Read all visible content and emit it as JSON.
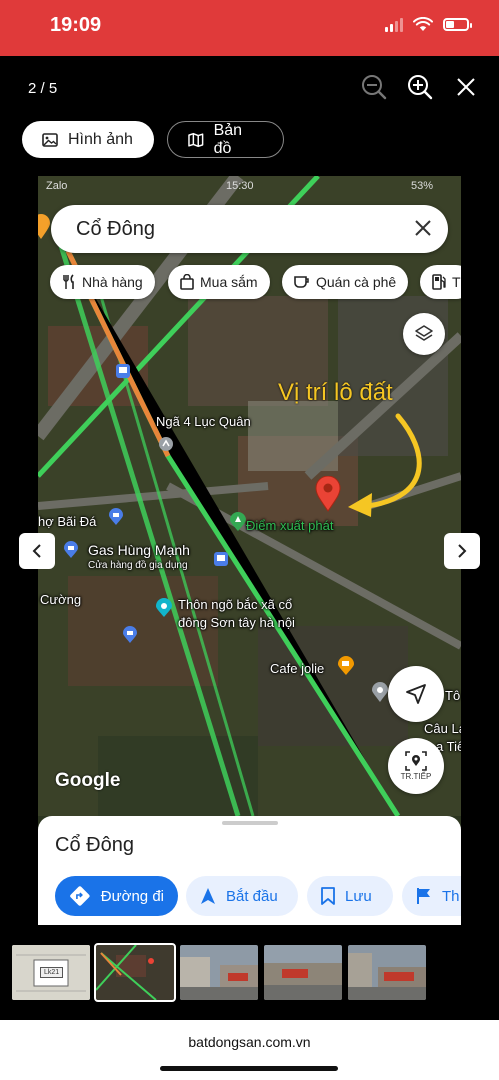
{
  "status": {
    "time": "19:09"
  },
  "viewer": {
    "counter": "2 / 5"
  },
  "tabs": {
    "images": "Hình ảnh",
    "map": "Bản đồ"
  },
  "photo": {
    "mini_status": {
      "carrier": "Zalo",
      "time": "15:30",
      "battery": "53%"
    },
    "search": {
      "query": "Cổ Đông"
    },
    "chips": [
      "Nhà hàng",
      "Mua sắm",
      "Quán cà phê",
      "T"
    ],
    "labels": {
      "intersection": "Ngã 4 Lục Quân",
      "gas_station": "Gas Hùng Mạnh",
      "gas_station_sub": "Cửa hàng đồ gia dụng",
      "market": "hợ Bãi Đá",
      "cuong": "Cường",
      "village": "Thôn ngõ bắc xã cổ đông Sơn tây hà nội",
      "start_point": "Điểm xuất phát",
      "cafe": "Cafe jolie",
      "right_edge_1": "Tô",
      "right_edge_2": "Câu Lạc",
      "right_edge_3": "a Tiê"
    },
    "annotation": "Vị trí lô đất",
    "google_logo": "Google",
    "streetview_label": "TR.TIẾP",
    "sheet": {
      "title": "Cổ Đông",
      "actions": [
        "Đường đi",
        "Bắt đầu",
        "Lưu",
        "Th"
      ]
    }
  },
  "thumbnails": {
    "first_label": "Lk21"
  },
  "footer": {
    "domain": "batdongsan.com.vn"
  },
  "colors": {
    "status_bar": "#e03a3a",
    "google_blue": "#1a73e8",
    "annotation": "#f5c623",
    "road_green": "#3fcf5a"
  }
}
